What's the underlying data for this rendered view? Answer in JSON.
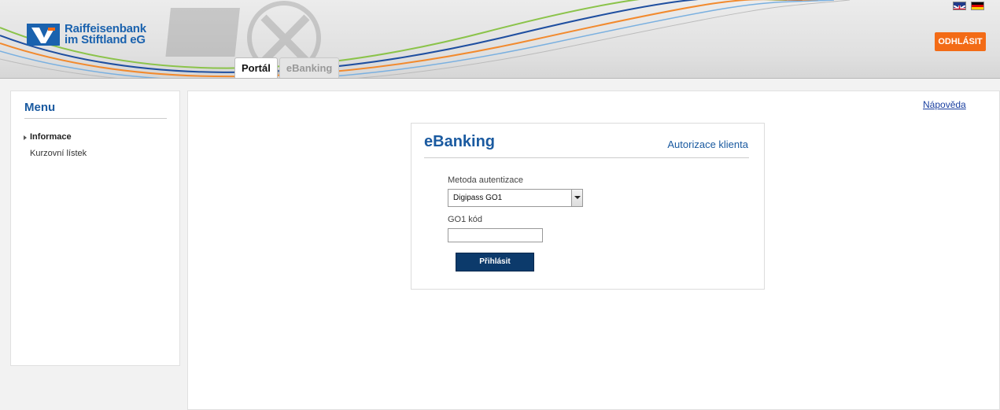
{
  "header": {
    "logo_line1": "Raiffeisenbank",
    "logo_line2": "im Stiftland eG",
    "logout_label": "ODHLÁSIT",
    "languages": [
      "English",
      "Deutsch"
    ]
  },
  "tabs": [
    {
      "label": "Portál",
      "active": true
    },
    {
      "label": "eBanking",
      "active": false
    }
  ],
  "sidebar": {
    "title": "Menu",
    "items": [
      {
        "label": "Informace",
        "active": true
      },
      {
        "label": "Kurzovní lístek",
        "active": false
      }
    ]
  },
  "main": {
    "help_link": "Nápověda",
    "login": {
      "title": "eBanking",
      "subtitle": "Autorizace klienta",
      "method_label": "Metoda autentizace",
      "method_value": "Digipass GO1",
      "code_label": "GO1 kód",
      "code_value": "",
      "submit_label": "Přihlásit"
    }
  },
  "colors": {
    "brand_blue": "#1a62ae",
    "logout_orange": "#f36b16",
    "submit_navy": "#0c3a6b"
  }
}
